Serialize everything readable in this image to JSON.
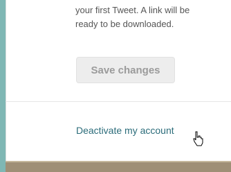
{
  "settings": {
    "download_info_line1": "your first Tweet. A link will be",
    "download_info_line2": "ready to be downloaded.",
    "save_button_label": "Save changes",
    "deactivate_link_label": "Deactivate my account"
  },
  "colors": {
    "background_frame": "#7fb7b4",
    "panel": "#ffffff",
    "link": "#2b6c7a",
    "disabled_button_text": "#9b9b9b"
  },
  "icons": {
    "cursor": "pointer-cursor-icon"
  }
}
